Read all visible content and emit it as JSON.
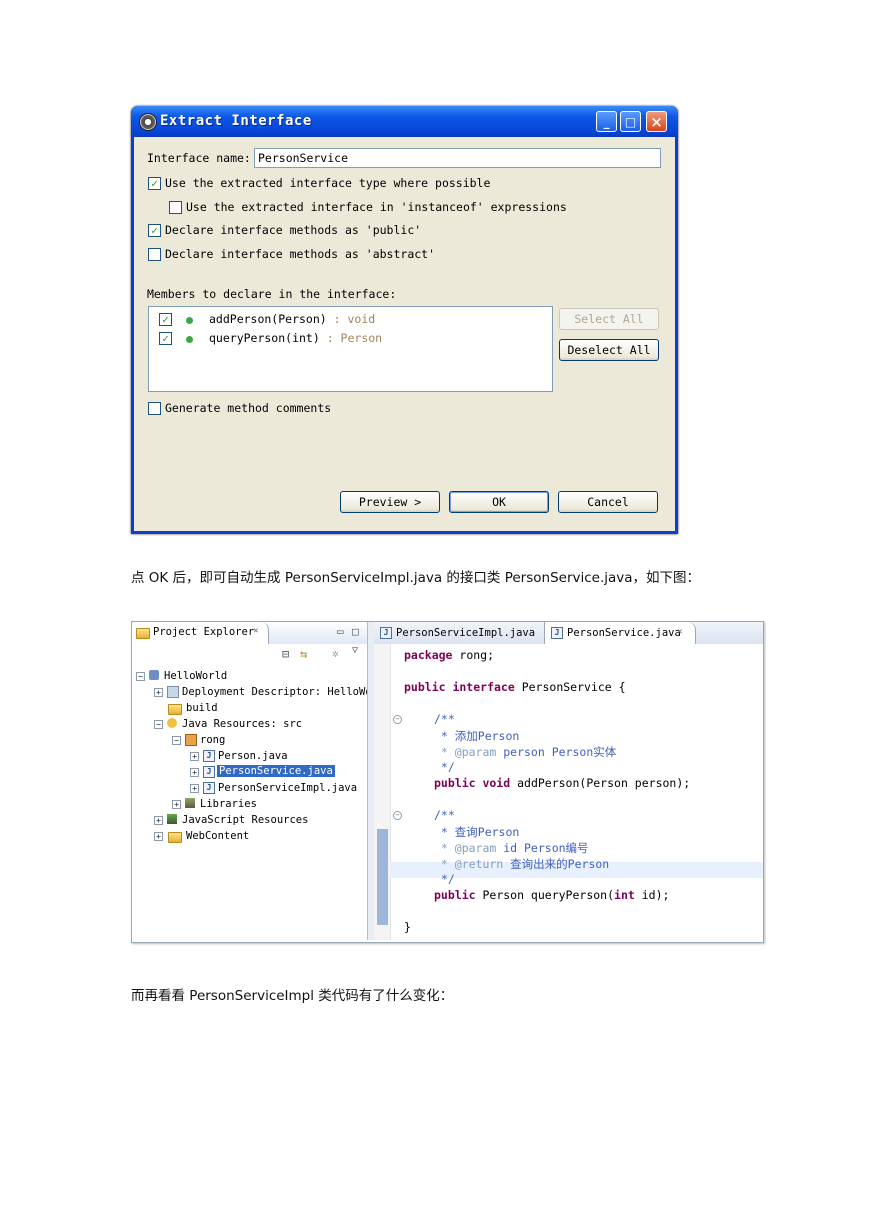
{
  "dialog": {
    "title": "Extract Interface",
    "interface_name_label": "Interface name:",
    "interface_name_value": "PersonService",
    "options": [
      {
        "label": "Use the extracted interface type where possible",
        "checked": true
      },
      {
        "label": "Use the extracted interface in 'instanceof' expressions",
        "checked": false
      },
      {
        "label": "Declare interface methods as 'public'",
        "checked": true
      },
      {
        "label": "Declare interface methods as 'abstract'",
        "checked": false
      }
    ],
    "members_label": "Members to declare in the interface:",
    "members": [
      {
        "name": "addPerson(Person)",
        "ret": " : void",
        "checked": true
      },
      {
        "name": "queryPerson(int)",
        "ret": " : Person",
        "checked": true
      }
    ],
    "select_all": "Select All",
    "deselect_all": "Deselect All",
    "generate_comments": {
      "label": "Generate method comments",
      "checked": false
    },
    "preview": "Preview >",
    "ok": "OK",
    "cancel": "Cancel"
  },
  "paragraph1": "点 OK 后，即可自动生成 PersonServiceImpl.java 的接口类 PersonService.java，如下图：",
  "paragraph2": "而再看看 PersonServiceImpl 类代码有了什么变化：",
  "explorer": {
    "tab_title": "Project Explorer",
    "tab_close": "✕",
    "tree": [
      {
        "label": "HelloWorld"
      },
      {
        "label": "Deployment Descriptor: HelloWor"
      },
      {
        "label": "build"
      },
      {
        "label": "Java Resources: src"
      },
      {
        "label": "rong"
      },
      {
        "label": "Person.java"
      },
      {
        "label": "PersonService.java"
      },
      {
        "label": "PersonServiceImpl.java"
      },
      {
        "label": "Libraries"
      },
      {
        "label": "JavaScript Resources"
      },
      {
        "label": "WebContent"
      }
    ]
  },
  "editor": {
    "tabs": [
      "PersonServiceImpl.java",
      "PersonService.java"
    ],
    "tab_close": "✕",
    "code": {
      "pkg_kw": "package",
      "pkg_name": " rong;",
      "decl_kw": "public interface",
      "decl_name": " PersonService {",
      "c1_open": "/**",
      "c1_line1": " * 添加Person",
      "c1_param_tag": " * @param",
      "c1_param_text": " person Person实体",
      "c1_close": " */",
      "m1_kw": "public void",
      "m1_rest": " addPerson(Person person);",
      "c2_open": "/**",
      "c2_line1": " * 查询Person",
      "c2_param_tag": " * @param",
      "c2_param_text": " id Person编号",
      "c2_return_tag": " * @return",
      "c2_return_text": " 查询出来的Person",
      "c2_close": " */",
      "m2_kw": "public",
      "m2_mid": " Person queryPerson(",
      "m2_int": "int",
      "m2_end": " id);",
      "close": "}"
    }
  },
  "colors": {
    "xp_title": "#0746d6",
    "keyword": "#7f0055",
    "comment": "#3f5fbf",
    "selection": "#3169c6"
  }
}
